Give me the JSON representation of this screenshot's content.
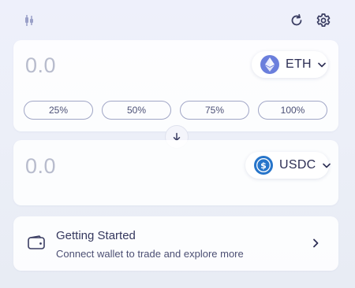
{
  "header": {
    "logo_icon": "candlestick-icon",
    "refresh_icon": "refresh-icon",
    "settings_icon": "gear-icon"
  },
  "from": {
    "amount": "0.0",
    "token": {
      "symbol": "ETH",
      "icon": "ethereum-icon",
      "color": "#6b7fdc"
    },
    "percent_buttons": [
      "25%",
      "50%",
      "75%",
      "100%"
    ]
  },
  "swap": {
    "icon": "arrow-down-icon"
  },
  "to": {
    "amount": "0.0",
    "token": {
      "symbol": "USDC",
      "icon": "usdc-icon",
      "color": "#2775ca"
    }
  },
  "getting_started": {
    "icon": "wallet-icon",
    "title": "Getting Started",
    "subtitle": "Connect wallet to trade and explore more",
    "arrow_icon": "chevron-right-icon"
  },
  "colors": {
    "accent": "#6b7fdc",
    "usdc": "#2775ca",
    "text": "#2d2f55",
    "placeholder": "#b8bccd"
  }
}
